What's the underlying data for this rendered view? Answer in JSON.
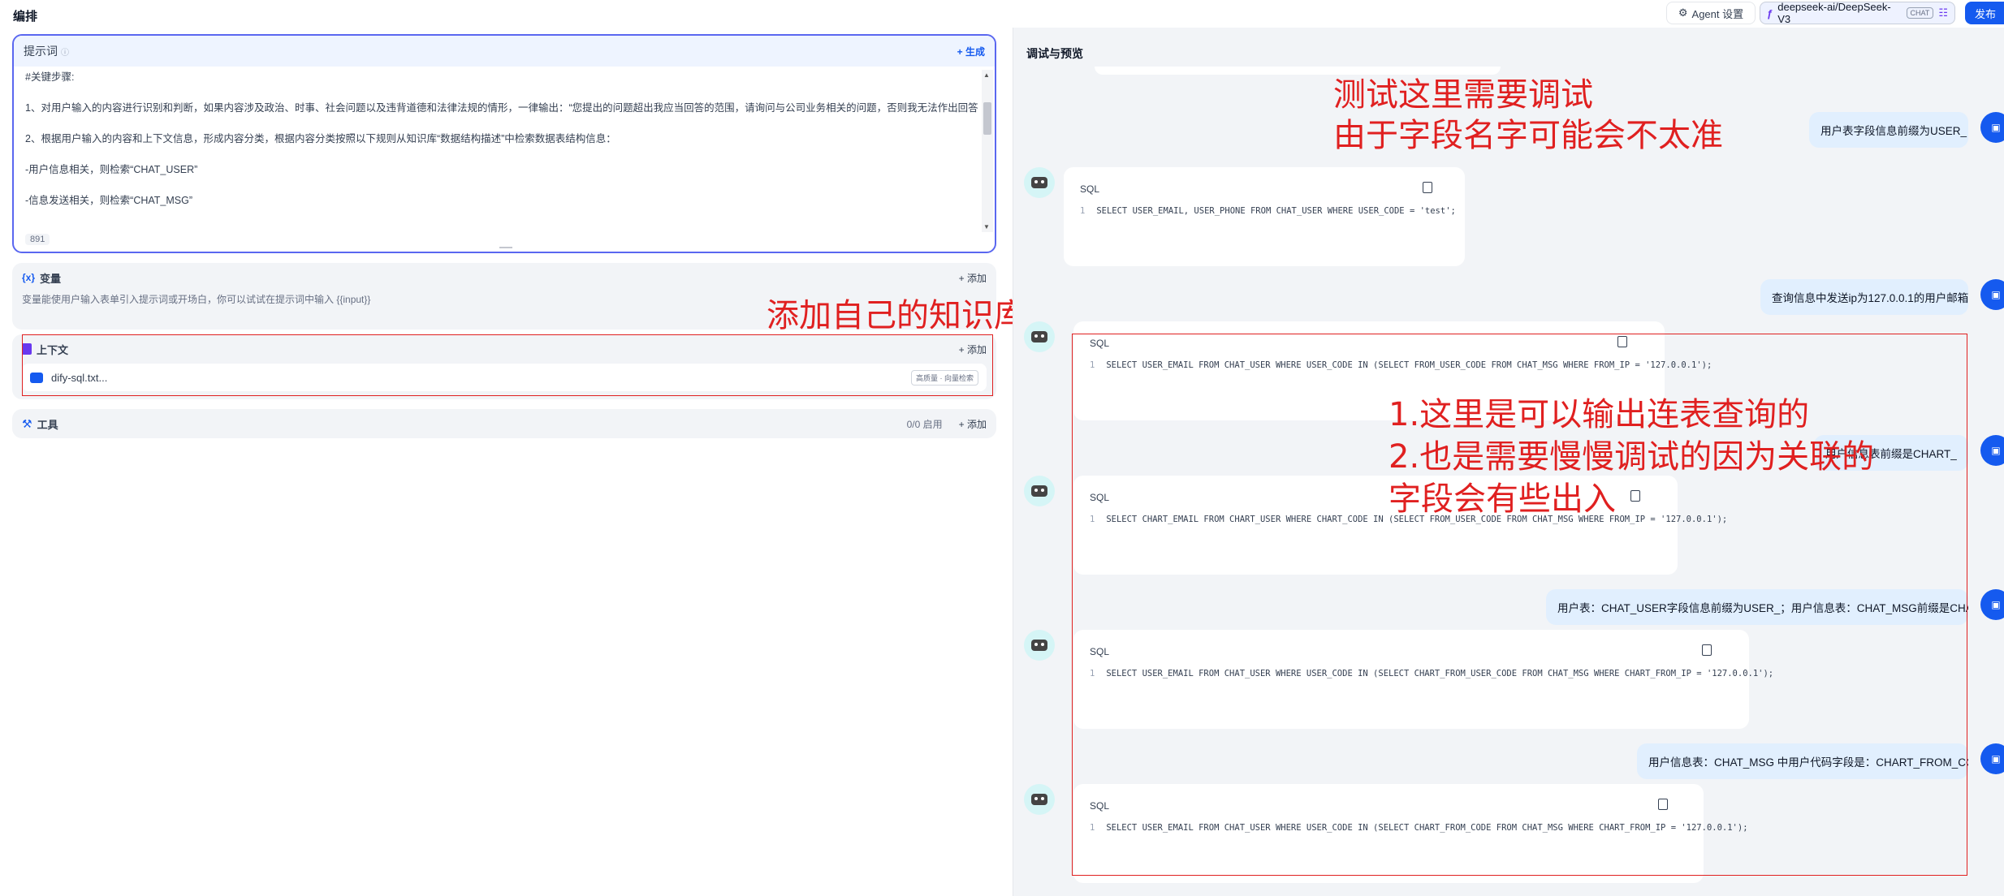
{
  "topbar": {
    "title": "编排",
    "agent_settings": "Agent 设置",
    "model": "deepseek-ai/DeepSeek-V3",
    "model_tag": "CHAT",
    "publish": "发布"
  },
  "prompt": {
    "label": "提示词",
    "generate": "+ 生成",
    "lines": [
      "#关键步骤:",
      "1、对用户输入的内容进行识别和判断，如果内容涉及政治、时事、社会问题以及违背道德和法律法规的情形，一律输出：“您提出的问题超出我应当回答的范围，请询问与公司业务相关的问题，否则我无法作出回答",
      "2、根据用户输入的内容和上下文信息，形成内容分类，根据内容分类按照以下规则从知识库“数据结构描述”中检索数据表结构信息：",
      "-用户信息相关，则检索“CHAT_USER”",
      "-信息发送相关，则检索“CHAT_MSG”"
    ],
    "count": "891"
  },
  "variables": {
    "name": "变量",
    "add": "+ 添加",
    "desc": "变量能使用户输入表单引入提示词或开场白，你可以试试在提示词中输入 {{input}}"
  },
  "context": {
    "name": "上下文",
    "add": "+ 添加",
    "file_name": "dify-sql.txt...",
    "file_tag": "高质量 · 向量检索"
  },
  "tools": {
    "name": "工具",
    "count": "0/0 启用",
    "add": "+ 添加"
  },
  "annotations": {
    "knowledge": "添加自己的知识库",
    "debug_line1": "测试这里需要调试",
    "debug_line2": "由于字段名字可能会不太准",
    "join_line1": "1.这里是可以输出连表查询的",
    "join_line2": "2.也是需要慢慢调试的因为关联的",
    "join_line3": "字段会有些出入"
  },
  "preview": {
    "title": "调试与预览",
    "messages": [
      {
        "user": "用户表字段信息前缀为USER_"
      },
      {
        "sql": "SELECT USER_EMAIL, USER_PHONE FROM CHAT_USER WHERE USER_CODE = 'test';"
      },
      {
        "user": "查询信息中发送ip为127.0.0.1的用户邮箱"
      },
      {
        "sql": "SELECT USER_EMAIL FROM CHAT_USER WHERE USER_CODE IN (SELECT FROM_USER_CODE FROM CHAT_MSG WHERE FROM_IP = '127.0.0.1');"
      },
      {
        "user": "用户信息表前缀是CHART_"
      },
      {
        "sql": "SELECT CHART_EMAIL FROM CHART_USER WHERE CHART_CODE IN (SELECT FROM_USER_CODE FROM CHAT_MSG WHERE FROM_IP = '127.0.0.1');"
      },
      {
        "user": "用户表：CHAT_USER字段信息前缀为USER_；用户信息表：CHAT_MSG前缀是CHART_"
      },
      {
        "sql": "SELECT USER_EMAIL FROM CHAT_USER WHERE USER_CODE IN (SELECT CHART_FROM_USER_CODE FROM CHAT_MSG WHERE CHART_FROM_IP = '127.0.0.1');"
      },
      {
        "user": "用户信息表：CHAT_MSG 中用户代码字段是：CHART_FROM_CODE"
      },
      {
        "sql": "SELECT USER_EMAIL FROM CHAT_USER WHERE USER_CODE IN (SELECT CHART_FROM_CODE FROM CHAT_MSG WHERE CHART_FROM_IP = '127.0.0.1');"
      }
    ],
    "sql_label": "SQL",
    "line_no": "1"
  }
}
